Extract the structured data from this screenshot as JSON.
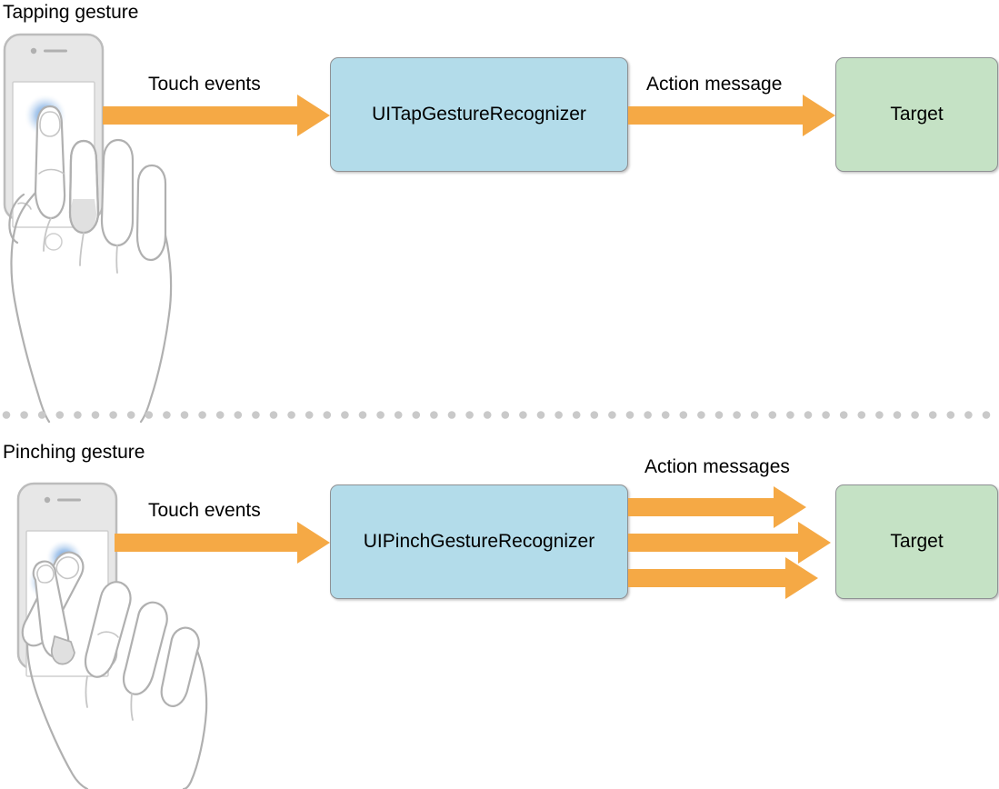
{
  "diagram": {
    "title_semantic": "gesture-recognizer-flow",
    "colors": {
      "arrow_orange": "#f5a945",
      "recognizer_blue": "#b3dcea",
      "target_green": "#c5e2c5",
      "box_border_gray": "#8f9194",
      "divider_dot_gray": "#c9c9c9",
      "hand_line_gray": "#b0b0b0",
      "phone_body_gray": "#e6e6e6",
      "touch_glow_blue": "#3d7fd1",
      "background": "#ffffff"
    }
  },
  "sections": [
    {
      "id": "tapping",
      "title": "Tapping gesture",
      "input_label": "Touch events",
      "recognizer": "UITapGestureRecognizer",
      "output_label": "Action message",
      "target": "Target",
      "action_arrow_count": 1,
      "device_icon": "phone-tap-gesture-icon"
    },
    {
      "id": "pinching",
      "title": "Pinching gesture",
      "input_label": "Touch events",
      "recognizer": "UIPinchGestureRecognizer",
      "output_label": "Action messages",
      "target": "Target",
      "action_arrow_count": 3,
      "device_icon": "phone-pinch-gesture-icon"
    }
  ],
  "divider": {
    "style": "dotted",
    "dot_count": 56
  }
}
